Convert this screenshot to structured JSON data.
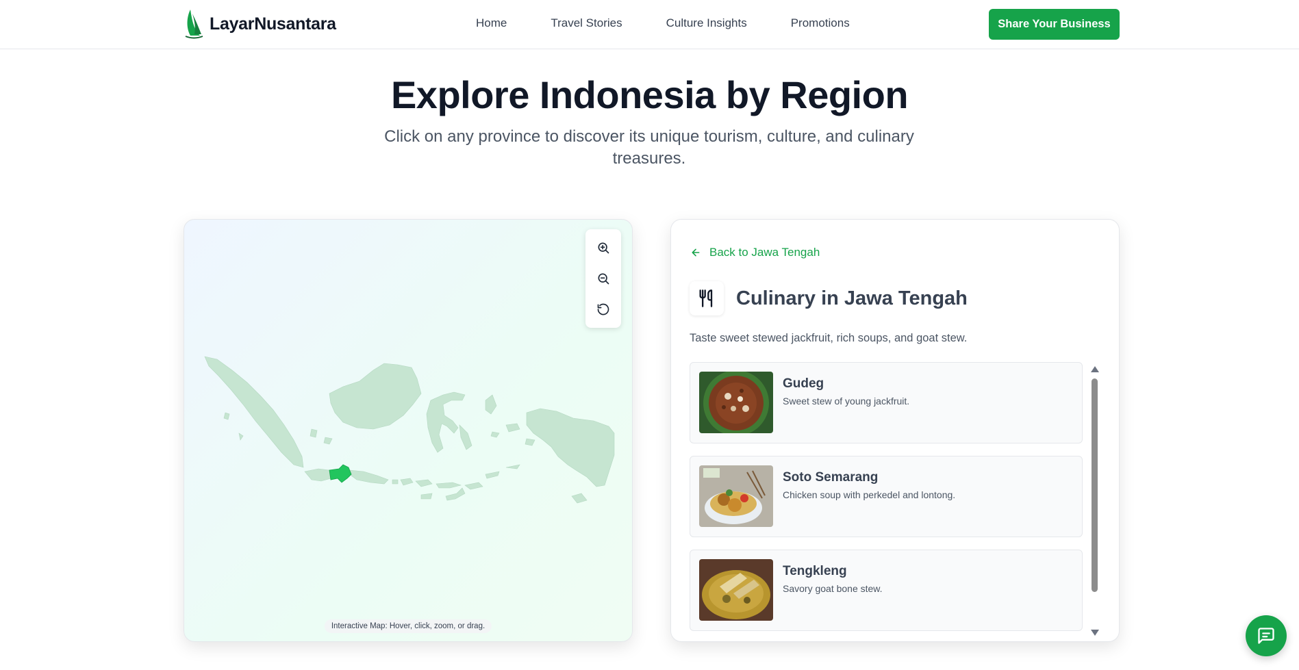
{
  "brand": {
    "name": "LayarNusantara",
    "accent": "#16a34a"
  },
  "nav": {
    "items": [
      {
        "label": "Home"
      },
      {
        "label": "Travel Stories"
      },
      {
        "label": "Culture Insights"
      },
      {
        "label": "Promotions"
      }
    ],
    "cta_label": "Share Your Business"
  },
  "hero": {
    "title": "Explore Indonesia by Region",
    "subtitle": "Click on any province to discover its unique tourism, culture, and culinary treasures."
  },
  "map": {
    "caption": "Interactive Map: Hover, click, zoom, or drag.",
    "controls": [
      "zoom-in-icon",
      "zoom-out-icon",
      "reset-icon"
    ],
    "selected_region_color": "#22c55e",
    "region_color": "#c6e5d1"
  },
  "panel": {
    "back_label": "Back to Jawa Tengah",
    "title": "Culinary in Jawa Tengah",
    "description": "Taste sweet stewed jackfruit, rich soups, and goat stew.",
    "items": [
      {
        "name": "Gudeg",
        "desc": "Sweet stew of young jackfruit."
      },
      {
        "name": "Soto Semarang",
        "desc": "Chicken soup with perkedel and lontong."
      },
      {
        "name": "Tengkleng",
        "desc": "Savory goat bone stew."
      }
    ]
  },
  "chat": {
    "icon": "chat-icon"
  }
}
